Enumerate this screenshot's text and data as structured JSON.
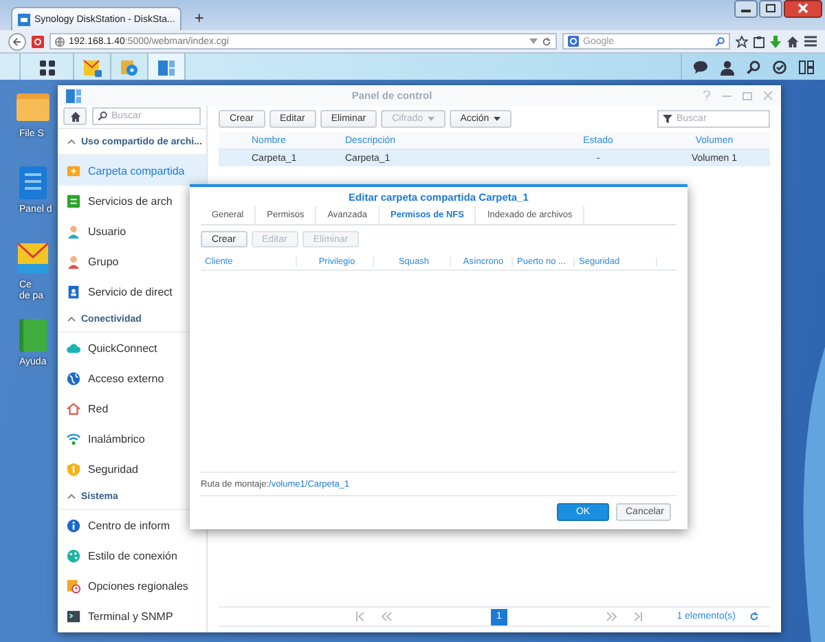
{
  "browser": {
    "tab_title": "Synology DiskStation - DiskSta...",
    "new_tab": "+",
    "url": "**192.168.1.40**:5000/webman/index.cgi",
    "search_placeholder": "Google"
  },
  "desktop_icons": [
    {
      "lines": [
        "File S"
      ]
    },
    {
      "lines": [
        "Panel d"
      ]
    },
    {
      "lines": [
        "Ce",
        "de pa"
      ]
    },
    {
      "lines": [
        "Ayuda"
      ]
    }
  ],
  "control_panel": {
    "title": "Panel de control",
    "search_placeholder": "Buscar",
    "sidebar": [
      {
        "kind": "header",
        "label": "Uso compartido de archi..."
      },
      {
        "kind": "item",
        "label": "Carpeta compartida",
        "selected": true
      },
      {
        "kind": "item",
        "label": "Servicios de arch",
        "selected": false
      },
      {
        "kind": "item",
        "label": "Usuario",
        "selected": false
      },
      {
        "kind": "item",
        "label": "Grupo",
        "selected": false
      },
      {
        "kind": "item",
        "label": "Servicio de direct",
        "selected": false
      },
      {
        "kind": "header",
        "label": "Conectividad"
      },
      {
        "kind": "item",
        "label": "QuickConnect",
        "selected": false
      },
      {
        "kind": "item",
        "label": "Acceso externo",
        "selected": false
      },
      {
        "kind": "item",
        "label": "Red",
        "selected": false
      },
      {
        "kind": "item",
        "label": "Inalámbrico",
        "selected": false
      },
      {
        "kind": "item",
        "label": "Seguridad",
        "selected": false
      },
      {
        "kind": "header",
        "label": "Sistema"
      },
      {
        "kind": "item",
        "label": "Centro de inform",
        "selected": false
      },
      {
        "kind": "item",
        "label": "Estilo de conexión",
        "selected": false
      },
      {
        "kind": "item",
        "label": "Opciones regionales",
        "selected": false
      },
      {
        "kind": "item",
        "label": "Terminal y SNMP",
        "selected": false
      }
    ],
    "toolbar": [
      {
        "label": "Crear",
        "disabled": false,
        "dropdown": false
      },
      {
        "label": "Editar",
        "disabled": false,
        "dropdown": false
      },
      {
        "label": "Eliminar",
        "disabled": false,
        "dropdown": false
      },
      {
        "label": "Cifrado",
        "disabled": true,
        "dropdown": true
      },
      {
        "label": "Acción",
        "disabled": false,
        "dropdown": true
      }
    ],
    "filter_placeholder": "Buscar",
    "table": {
      "columns": [
        "Nombre",
        "Descripción",
        "Estado",
        "Volumen"
      ],
      "rows": [
        {
          "cells": [
            "Carpeta_1",
            "Carpeta_1",
            "-",
            "Volumen 1"
          ],
          "selected": true
        }
      ]
    },
    "pager": {
      "page": "1",
      "count": "1 elemento(s)"
    }
  },
  "dialog": {
    "title": "Editar carpeta compartida Carpeta_1",
    "tabs": [
      {
        "label": "General",
        "selected": false
      },
      {
        "label": "Permisos",
        "selected": false
      },
      {
        "label": "Avanzada",
        "selected": false
      },
      {
        "label": "Permisos de NFS",
        "selected": true
      },
      {
        "label": "Indexado de archivos",
        "selected": false
      }
    ],
    "toolbar": [
      {
        "label": "Crear",
        "disabled": false
      },
      {
        "label": "Editar",
        "disabled": true
      },
      {
        "label": "Eliminar",
        "disabled": true
      }
    ],
    "columns": [
      "Cliente",
      "Privilegio",
      "Squash",
      "Asíncrono",
      "Puerto no ...",
      "Seguridad"
    ],
    "mount_label": "Ruta de montaje:",
    "mount_path": "/volume1/Carpeta_1",
    "buttons": [
      {
        "label": "OK",
        "kind": "primary"
      },
      {
        "label": "Cancelar",
        "kind": "secondary"
      }
    ]
  }
}
